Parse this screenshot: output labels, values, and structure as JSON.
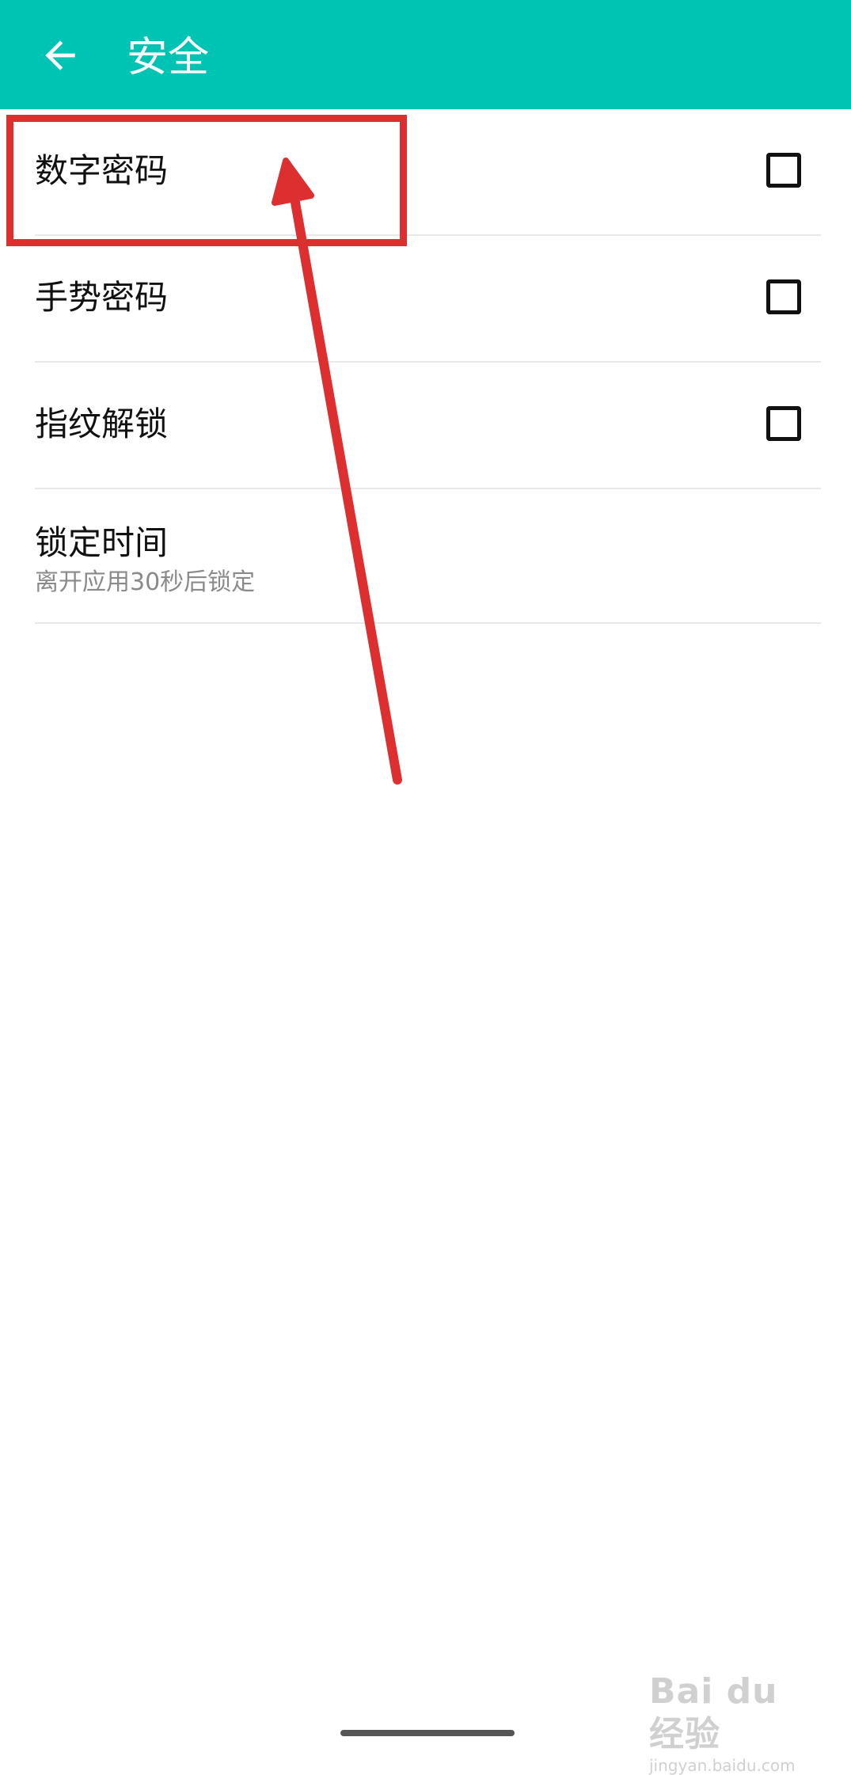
{
  "appbar": {
    "title": "安全",
    "back_icon": "arrow-left-icon",
    "background_color": "#00c4b3"
  },
  "settings": {
    "items": [
      {
        "label": "数字密码",
        "checked": false
      },
      {
        "label": "手势密码",
        "checked": false
      },
      {
        "label": "指纹解锁",
        "checked": false
      },
      {
        "label": "锁定时间",
        "subtitle": "离开应用30秒后锁定"
      }
    ]
  },
  "annotation": {
    "color": "#dd2f2f"
  },
  "watermark": {
    "main": "Bai du 经验",
    "sub": "jingyan.baidu.com"
  }
}
